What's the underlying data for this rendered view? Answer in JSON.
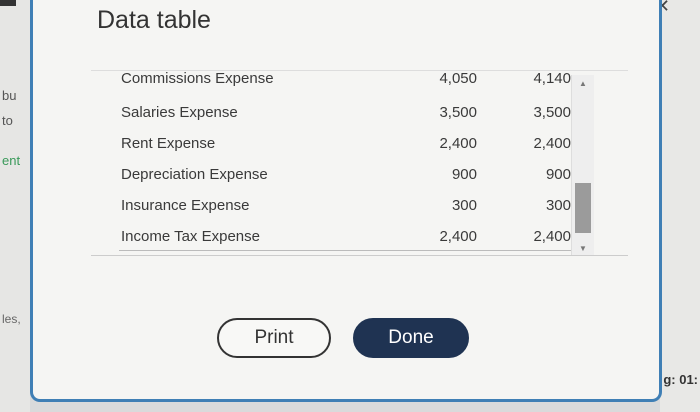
{
  "background": {
    "left_texts": [
      "bu",
      "to",
      "ent",
      "les,"
    ],
    "right_text": "g: 01:"
  },
  "dialog": {
    "title": "Data table",
    "rows": [
      {
        "label": "Commissions Expense",
        "v1": "4,050",
        "v2": "4,140"
      },
      {
        "label": "Salaries Expense",
        "v1": "3,500",
        "v2": "3,500"
      },
      {
        "label": "Rent Expense",
        "v1": "2,400",
        "v2": "2,400"
      },
      {
        "label": "Depreciation Expense",
        "v1": "900",
        "v2": "900"
      },
      {
        "label": "Insurance Expense",
        "v1": "300",
        "v2": "300"
      },
      {
        "label": "Income Tax Expense",
        "v1": "2,400",
        "v2": "2,400"
      }
    ],
    "print_label": "Print",
    "done_label": "Done"
  },
  "colors": {
    "accent": "#3f7fb5",
    "done_button": "#1f3352"
  }
}
